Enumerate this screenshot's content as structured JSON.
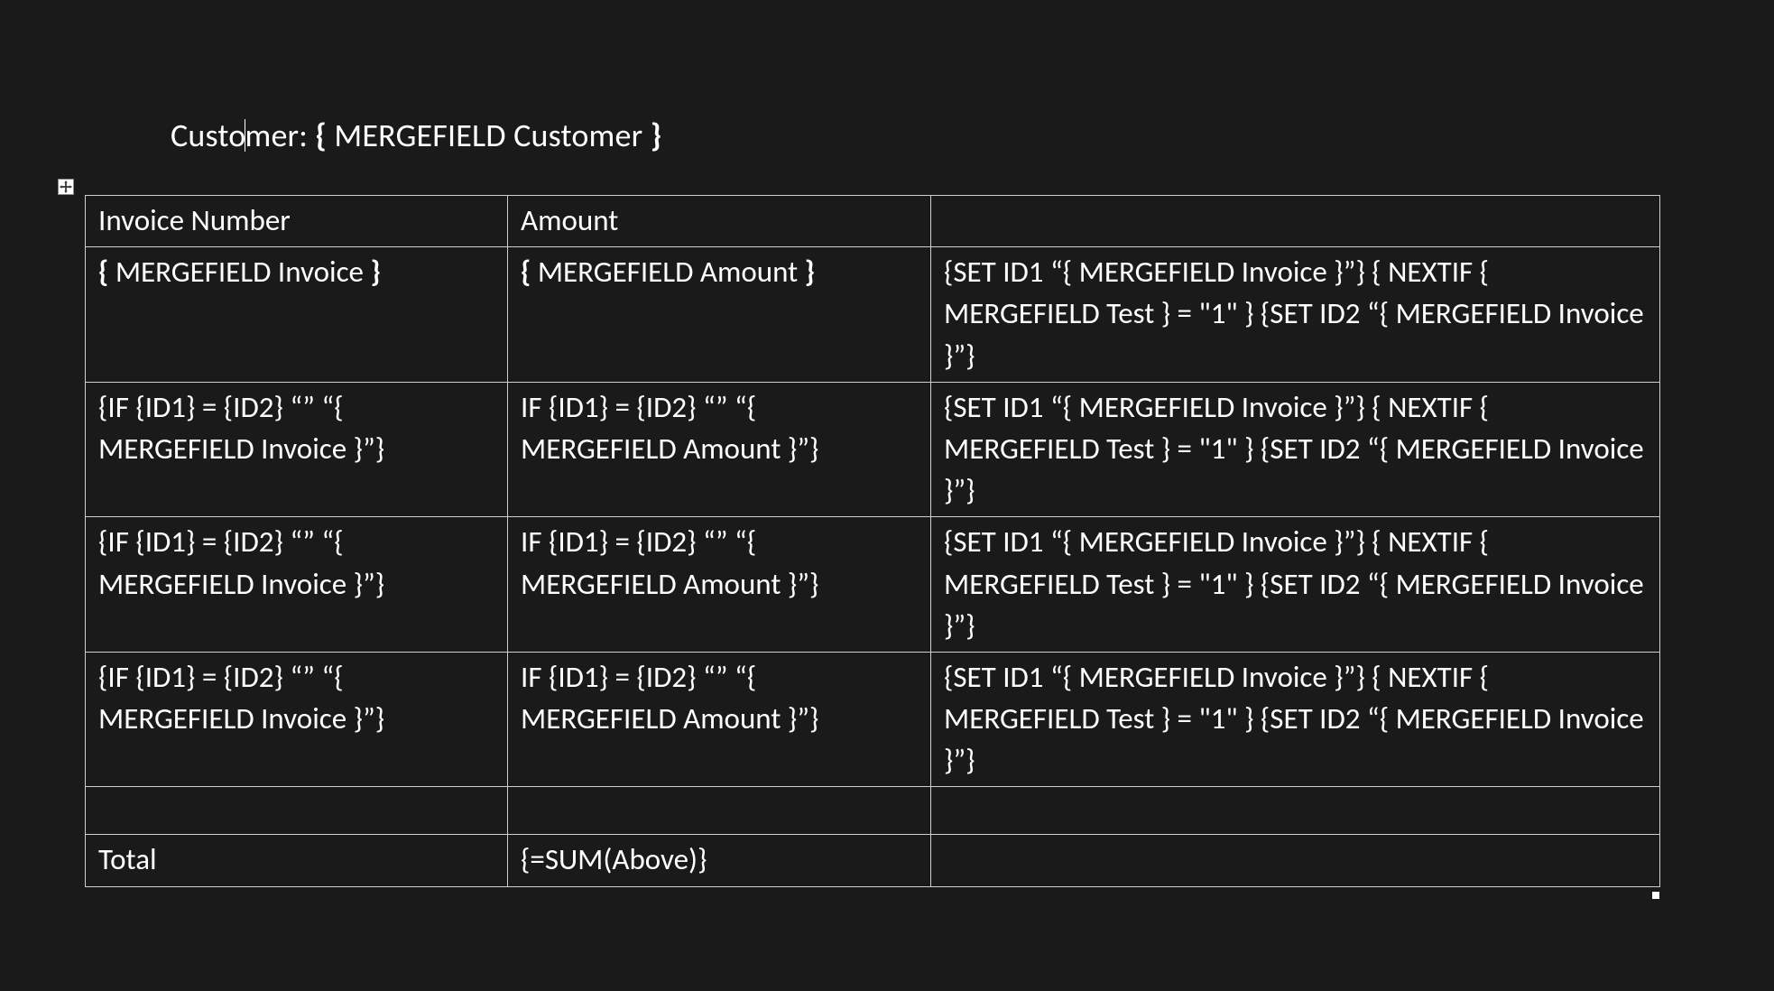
{
  "customer_line": {
    "prefix1": "Custo",
    "prefix2": "mer: ",
    "brace_open": "{ ",
    "field": "MERGEFIELD Customer ",
    "brace_close": "}"
  },
  "table": {
    "headers": {
      "col1": "Invoice Number",
      "col2": "Amount",
      "col3": ""
    },
    "rows": [
      {
        "col1_parts": [
          "{ ",
          "MERGEFIELD Invoice ",
          "}"
        ],
        "col2_parts": [
          "{ ",
          "MERGEFIELD Amount ",
          "}"
        ],
        "col3": "{SET ID1 “{ MERGEFIELD Invoice }”} { NEXTIF { MERGEFIELD Test } = \"1\"  } {SET ID2 “{ MERGEFIELD Invoice }”}"
      },
      {
        "col1": "{IF {ID1} = {ID2} “” “{ MERGEFIELD Invoice }”}",
        "col2": "IF {ID1} = {ID2} “” “{ MERGEFIELD Amount }”}",
        "col3": "{SET ID1 “{ MERGEFIELD Invoice }”} { NEXTIF { MERGEFIELD Test } = \"1\"  } {SET ID2 “{ MERGEFIELD Invoice }”}"
      },
      {
        "col1": "{IF {ID1} = {ID2} “” “{ MERGEFIELD Invoice }”}",
        "col2": "IF {ID1} = {ID2} “” “{ MERGEFIELD Amount }”}",
        "col3": "{SET ID1 “{ MERGEFIELD Invoice }”} { NEXTIF { MERGEFIELD Test } = \"1\"  } {SET ID2 “{ MERGEFIELD Invoice }”}"
      },
      {
        "col1": "{IF {ID1} = {ID2} “” “{ MERGEFIELD Invoice }”}",
        "col2": "IF {ID1} = {ID2} “” “{ MERGEFIELD Amount }”}",
        "col3": "{SET ID1 “{ MERGEFIELD Invoice }”} { NEXTIF { MERGEFIELD Test } = \"1\"  } {SET ID2 “{ MERGEFIELD Invoice }”}"
      }
    ],
    "empty_row": {
      "col1": "",
      "col2": "",
      "col3": ""
    },
    "total_row": {
      "col1": "Total",
      "col2": "{=SUM(Above)}",
      "col3": ""
    }
  }
}
